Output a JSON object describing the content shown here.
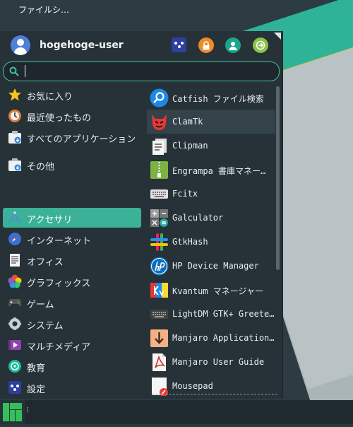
{
  "desktop": {
    "icon_label": "ファイルシ…"
  },
  "header": {
    "username": "hogehoge-user",
    "buttons": [
      "settings-icon",
      "lock-icon",
      "user-icon",
      "logout-icon"
    ]
  },
  "search": {
    "value": "",
    "placeholder": ""
  },
  "categories": [
    {
      "label": "お気に入り",
      "icon": "star-icon"
    },
    {
      "label": "最近使ったもの",
      "icon": "recent-icon"
    },
    {
      "label": "すべてのアプリケーション",
      "icon": "all-apps-icon"
    },
    {
      "label": "その他",
      "icon": "other-icon"
    },
    {
      "label": "アクセサリ",
      "icon": "accessories-icon",
      "selected": true
    },
    {
      "label": "インターネット",
      "icon": "internet-icon"
    },
    {
      "label": "オフィス",
      "icon": "office-icon"
    },
    {
      "label": "グラフィックス",
      "icon": "graphics-icon"
    },
    {
      "label": "ゲーム",
      "icon": "games-icon"
    },
    {
      "label": "システム",
      "icon": "system-icon"
    },
    {
      "label": "マルチメディア",
      "icon": "multimedia-icon"
    },
    {
      "label": "教育",
      "icon": "education-icon"
    },
    {
      "label": "設定",
      "icon": "settings-icon"
    }
  ],
  "apps": [
    {
      "label": "Catfish ファイル検索",
      "icon": "catfish-icon"
    },
    {
      "label": "ClamTk",
      "icon": "clamtk-icon",
      "hover": true
    },
    {
      "label": "Clipman",
      "icon": "clipman-icon"
    },
    {
      "label": "Engrampa 書庫マネー…",
      "icon": "engrampa-icon"
    },
    {
      "label": "Fcitx",
      "icon": "keyboard-icon"
    },
    {
      "label": "Galculator",
      "icon": "calculator-icon"
    },
    {
      "label": "GtkHash",
      "icon": "gtkhash-icon"
    },
    {
      "label": "HP Device Manager",
      "icon": "hp-icon"
    },
    {
      "label": "Kvantum マネージャー",
      "icon": "kvantum-icon"
    },
    {
      "label": "LightDM GTK+ Greete…",
      "icon": "lightdm-icon"
    },
    {
      "label": "Manjaro Application…",
      "icon": "download-icon"
    },
    {
      "label": "Manjaro User Guide",
      "icon": "pdf-icon"
    },
    {
      "label": "Mousepad",
      "icon": "mousepad-icon"
    }
  ],
  "taskbar": {
    "handle": "⠇"
  },
  "colors": {
    "accent": "#3bb197",
    "menu_bg": "#263238",
    "desktop_teal": "#2eb398",
    "desktop_yellow": "#d9c51c"
  }
}
